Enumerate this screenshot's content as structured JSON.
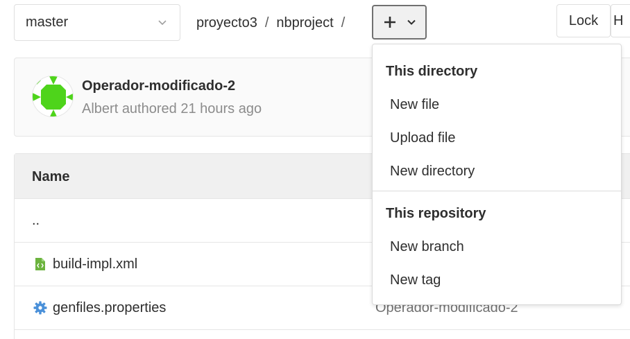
{
  "branch_select": {
    "value": "master",
    "icon": "chevron-down-icon"
  },
  "breadcrumb": {
    "project": "proyecto3",
    "sep1": "/",
    "folder": "nbproject",
    "sep2": "/"
  },
  "add_button": {
    "icon_plus": "plus-icon",
    "icon_chevron": "chevron-down-icon"
  },
  "actions": {
    "lock_label": "Lock",
    "h_label": "H"
  },
  "last_commit": {
    "title": "Operador-modificado-2",
    "author": "Albert",
    "meta_suffix": "authored 21 hours ago",
    "avatar_color": "#4ed41b"
  },
  "tree": {
    "header_name": "Name",
    "rows": [
      {
        "name": "..",
        "commit": ""
      },
      {
        "name": "build-impl.xml",
        "icon": "xml-file-icon",
        "icon_color": "#6cb33e",
        "commit": ""
      },
      {
        "name": "genfiles.properties",
        "icon": "gear-icon",
        "icon_color": "#4a90d9",
        "commit": "Operador-modificado-2"
      }
    ]
  },
  "dropdown": {
    "section1_header": "This directory",
    "section1_items": [
      "New file",
      "Upload file",
      "New directory"
    ],
    "section2_header": "This repository",
    "section2_items": [
      "New branch",
      "New tag"
    ]
  }
}
